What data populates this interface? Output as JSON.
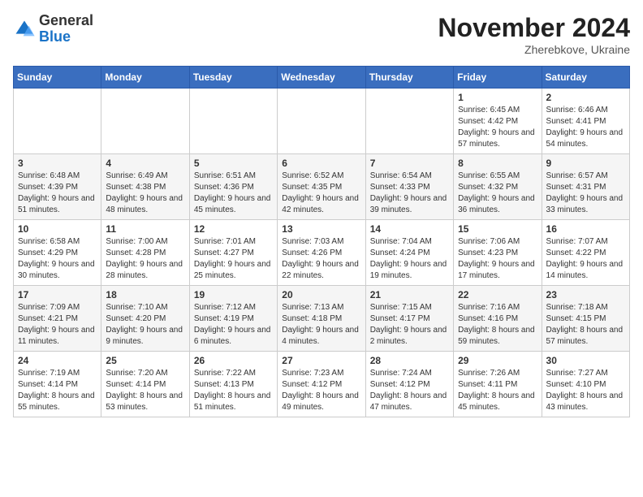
{
  "logo": {
    "general": "General",
    "blue": "Blue"
  },
  "header": {
    "month": "November 2024",
    "location": "Zherebkove, Ukraine"
  },
  "weekdays": [
    "Sunday",
    "Monday",
    "Tuesday",
    "Wednesday",
    "Thursday",
    "Friday",
    "Saturday"
  ],
  "weeks": [
    [
      {
        "day": "",
        "info": ""
      },
      {
        "day": "",
        "info": ""
      },
      {
        "day": "",
        "info": ""
      },
      {
        "day": "",
        "info": ""
      },
      {
        "day": "",
        "info": ""
      },
      {
        "day": "1",
        "info": "Sunrise: 6:45 AM\nSunset: 4:42 PM\nDaylight: 9 hours and 57 minutes."
      },
      {
        "day": "2",
        "info": "Sunrise: 6:46 AM\nSunset: 4:41 PM\nDaylight: 9 hours and 54 minutes."
      }
    ],
    [
      {
        "day": "3",
        "info": "Sunrise: 6:48 AM\nSunset: 4:39 PM\nDaylight: 9 hours and 51 minutes."
      },
      {
        "day": "4",
        "info": "Sunrise: 6:49 AM\nSunset: 4:38 PM\nDaylight: 9 hours and 48 minutes."
      },
      {
        "day": "5",
        "info": "Sunrise: 6:51 AM\nSunset: 4:36 PM\nDaylight: 9 hours and 45 minutes."
      },
      {
        "day": "6",
        "info": "Sunrise: 6:52 AM\nSunset: 4:35 PM\nDaylight: 9 hours and 42 minutes."
      },
      {
        "day": "7",
        "info": "Sunrise: 6:54 AM\nSunset: 4:33 PM\nDaylight: 9 hours and 39 minutes."
      },
      {
        "day": "8",
        "info": "Sunrise: 6:55 AM\nSunset: 4:32 PM\nDaylight: 9 hours and 36 minutes."
      },
      {
        "day": "9",
        "info": "Sunrise: 6:57 AM\nSunset: 4:31 PM\nDaylight: 9 hours and 33 minutes."
      }
    ],
    [
      {
        "day": "10",
        "info": "Sunrise: 6:58 AM\nSunset: 4:29 PM\nDaylight: 9 hours and 30 minutes."
      },
      {
        "day": "11",
        "info": "Sunrise: 7:00 AM\nSunset: 4:28 PM\nDaylight: 9 hours and 28 minutes."
      },
      {
        "day": "12",
        "info": "Sunrise: 7:01 AM\nSunset: 4:27 PM\nDaylight: 9 hours and 25 minutes."
      },
      {
        "day": "13",
        "info": "Sunrise: 7:03 AM\nSunset: 4:26 PM\nDaylight: 9 hours and 22 minutes."
      },
      {
        "day": "14",
        "info": "Sunrise: 7:04 AM\nSunset: 4:24 PM\nDaylight: 9 hours and 19 minutes."
      },
      {
        "day": "15",
        "info": "Sunrise: 7:06 AM\nSunset: 4:23 PM\nDaylight: 9 hours and 17 minutes."
      },
      {
        "day": "16",
        "info": "Sunrise: 7:07 AM\nSunset: 4:22 PM\nDaylight: 9 hours and 14 minutes."
      }
    ],
    [
      {
        "day": "17",
        "info": "Sunrise: 7:09 AM\nSunset: 4:21 PM\nDaylight: 9 hours and 11 minutes."
      },
      {
        "day": "18",
        "info": "Sunrise: 7:10 AM\nSunset: 4:20 PM\nDaylight: 9 hours and 9 minutes."
      },
      {
        "day": "19",
        "info": "Sunrise: 7:12 AM\nSunset: 4:19 PM\nDaylight: 9 hours and 6 minutes."
      },
      {
        "day": "20",
        "info": "Sunrise: 7:13 AM\nSunset: 4:18 PM\nDaylight: 9 hours and 4 minutes."
      },
      {
        "day": "21",
        "info": "Sunrise: 7:15 AM\nSunset: 4:17 PM\nDaylight: 9 hours and 2 minutes."
      },
      {
        "day": "22",
        "info": "Sunrise: 7:16 AM\nSunset: 4:16 PM\nDaylight: 8 hours and 59 minutes."
      },
      {
        "day": "23",
        "info": "Sunrise: 7:18 AM\nSunset: 4:15 PM\nDaylight: 8 hours and 57 minutes."
      }
    ],
    [
      {
        "day": "24",
        "info": "Sunrise: 7:19 AM\nSunset: 4:14 PM\nDaylight: 8 hours and 55 minutes."
      },
      {
        "day": "25",
        "info": "Sunrise: 7:20 AM\nSunset: 4:14 PM\nDaylight: 8 hours and 53 minutes."
      },
      {
        "day": "26",
        "info": "Sunrise: 7:22 AM\nSunset: 4:13 PM\nDaylight: 8 hours and 51 minutes."
      },
      {
        "day": "27",
        "info": "Sunrise: 7:23 AM\nSunset: 4:12 PM\nDaylight: 8 hours and 49 minutes."
      },
      {
        "day": "28",
        "info": "Sunrise: 7:24 AM\nSunset: 4:12 PM\nDaylight: 8 hours and 47 minutes."
      },
      {
        "day": "29",
        "info": "Sunrise: 7:26 AM\nSunset: 4:11 PM\nDaylight: 8 hours and 45 minutes."
      },
      {
        "day": "30",
        "info": "Sunrise: 7:27 AM\nSunset: 4:10 PM\nDaylight: 8 hours and 43 minutes."
      }
    ]
  ]
}
